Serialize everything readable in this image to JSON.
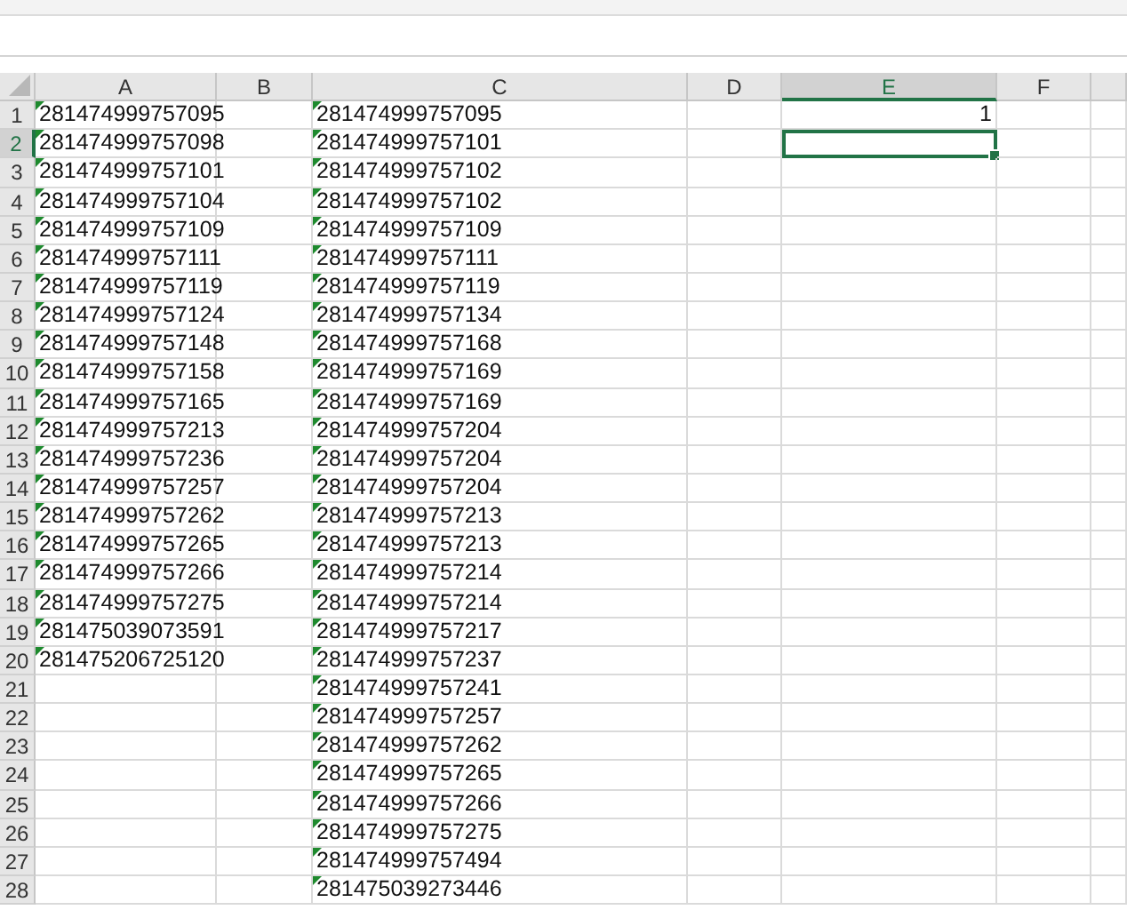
{
  "columns": [
    {
      "label": "A",
      "selected": false
    },
    {
      "label": "B",
      "selected": false
    },
    {
      "label": "C",
      "selected": false
    },
    {
      "label": "D",
      "selected": false
    },
    {
      "label": "E",
      "selected": true
    },
    {
      "label": "F",
      "selected": false
    }
  ],
  "rows": [
    {
      "number": "1",
      "selected": false,
      "cells": [
        {
          "value": "281474999757095",
          "flag": true,
          "selected": false
        },
        {
          "flag": false,
          "selected": false
        },
        {
          "value": "281474999757095",
          "flag": true,
          "selected": false
        },
        {
          "flag": false,
          "selected": false
        },
        {
          "value": "1",
          "flag": false,
          "selected": false
        },
        {
          "flag": false,
          "selected": false
        }
      ]
    },
    {
      "number": "2",
      "selected": true,
      "cells": [
        {
          "value": "281474999757098",
          "flag": true,
          "selected": false
        },
        {
          "flag": false,
          "selected": false
        },
        {
          "value": "281474999757101",
          "flag": true,
          "selected": false
        },
        {
          "flag": false,
          "selected": false
        },
        {
          "flag": false,
          "selected": true
        },
        {
          "flag": false,
          "selected": false
        }
      ]
    },
    {
      "number": "3",
      "selected": false,
      "cells": [
        {
          "value": "281474999757101",
          "flag": true,
          "selected": false
        },
        {
          "flag": false,
          "selected": false
        },
        {
          "value": "281474999757102",
          "flag": true,
          "selected": false
        },
        {
          "flag": false,
          "selected": false
        },
        {
          "flag": false,
          "selected": false
        },
        {
          "flag": false,
          "selected": false
        }
      ]
    },
    {
      "number": "4",
      "selected": false,
      "cells": [
        {
          "value": "281474999757104",
          "flag": true,
          "selected": false
        },
        {
          "flag": false,
          "selected": false
        },
        {
          "value": "281474999757102",
          "flag": true,
          "selected": false
        },
        {
          "flag": false,
          "selected": false
        },
        {
          "flag": false,
          "selected": false
        },
        {
          "flag": false,
          "selected": false
        }
      ]
    },
    {
      "number": "5",
      "selected": false,
      "cells": [
        {
          "value": "281474999757109",
          "flag": true,
          "selected": false
        },
        {
          "flag": false,
          "selected": false
        },
        {
          "value": "281474999757109",
          "flag": true,
          "selected": false
        },
        {
          "flag": false,
          "selected": false
        },
        {
          "flag": false,
          "selected": false
        },
        {
          "flag": false,
          "selected": false
        }
      ]
    },
    {
      "number": "6",
      "selected": false,
      "cells": [
        {
          "value": "281474999757111",
          "flag": true,
          "selected": false
        },
        {
          "flag": false,
          "selected": false
        },
        {
          "value": "281474999757111",
          "flag": true,
          "selected": false
        },
        {
          "flag": false,
          "selected": false
        },
        {
          "flag": false,
          "selected": false
        },
        {
          "flag": false,
          "selected": false
        }
      ]
    },
    {
      "number": "7",
      "selected": false,
      "cells": [
        {
          "value": "281474999757119",
          "flag": true,
          "selected": false
        },
        {
          "flag": false,
          "selected": false
        },
        {
          "value": "281474999757119",
          "flag": true,
          "selected": false
        },
        {
          "flag": false,
          "selected": false
        },
        {
          "flag": false,
          "selected": false
        },
        {
          "flag": false,
          "selected": false
        }
      ]
    },
    {
      "number": "8",
      "selected": false,
      "cells": [
        {
          "value": "281474999757124",
          "flag": true,
          "selected": false
        },
        {
          "flag": false,
          "selected": false
        },
        {
          "value": "281474999757134",
          "flag": true,
          "selected": false
        },
        {
          "flag": false,
          "selected": false
        },
        {
          "flag": false,
          "selected": false
        },
        {
          "flag": false,
          "selected": false
        }
      ]
    },
    {
      "number": "9",
      "selected": false,
      "cells": [
        {
          "value": "281474999757148",
          "flag": true,
          "selected": false
        },
        {
          "flag": false,
          "selected": false
        },
        {
          "value": "281474999757168",
          "flag": true,
          "selected": false
        },
        {
          "flag": false,
          "selected": false
        },
        {
          "flag": false,
          "selected": false
        },
        {
          "flag": false,
          "selected": false
        }
      ]
    },
    {
      "number": "10",
      "selected": false,
      "cells": [
        {
          "value": "281474999757158",
          "flag": true,
          "selected": false
        },
        {
          "flag": false,
          "selected": false
        },
        {
          "value": "281474999757169",
          "flag": true,
          "selected": false
        },
        {
          "flag": false,
          "selected": false
        },
        {
          "flag": false,
          "selected": false
        },
        {
          "flag": false,
          "selected": false
        }
      ]
    },
    {
      "number": "11",
      "selected": false,
      "cells": [
        {
          "value": "281474999757165",
          "flag": true,
          "selected": false
        },
        {
          "flag": false,
          "selected": false
        },
        {
          "value": "281474999757169",
          "flag": true,
          "selected": false
        },
        {
          "flag": false,
          "selected": false
        },
        {
          "flag": false,
          "selected": false
        },
        {
          "flag": false,
          "selected": false
        }
      ]
    },
    {
      "number": "12",
      "selected": false,
      "cells": [
        {
          "value": "281474999757213",
          "flag": true,
          "selected": false
        },
        {
          "flag": false,
          "selected": false
        },
        {
          "value": "281474999757204",
          "flag": true,
          "selected": false
        },
        {
          "flag": false,
          "selected": false
        },
        {
          "flag": false,
          "selected": false
        },
        {
          "flag": false,
          "selected": false
        }
      ]
    },
    {
      "number": "13",
      "selected": false,
      "cells": [
        {
          "value": "281474999757236",
          "flag": true,
          "selected": false
        },
        {
          "flag": false,
          "selected": false
        },
        {
          "value": "281474999757204",
          "flag": true,
          "selected": false
        },
        {
          "flag": false,
          "selected": false
        },
        {
          "flag": false,
          "selected": false
        },
        {
          "flag": false,
          "selected": false
        }
      ]
    },
    {
      "number": "14",
      "selected": false,
      "cells": [
        {
          "value": "281474999757257",
          "flag": true,
          "selected": false
        },
        {
          "flag": false,
          "selected": false
        },
        {
          "value": "281474999757204",
          "flag": true,
          "selected": false
        },
        {
          "flag": false,
          "selected": false
        },
        {
          "flag": false,
          "selected": false
        },
        {
          "flag": false,
          "selected": false
        }
      ]
    },
    {
      "number": "15",
      "selected": false,
      "cells": [
        {
          "value": "281474999757262",
          "flag": true,
          "selected": false
        },
        {
          "flag": false,
          "selected": false
        },
        {
          "value": "281474999757213",
          "flag": true,
          "selected": false
        },
        {
          "flag": false,
          "selected": false
        },
        {
          "flag": false,
          "selected": false
        },
        {
          "flag": false,
          "selected": false
        }
      ]
    },
    {
      "number": "16",
      "selected": false,
      "cells": [
        {
          "value": "281474999757265",
          "flag": true,
          "selected": false
        },
        {
          "flag": false,
          "selected": false
        },
        {
          "value": "281474999757213",
          "flag": true,
          "selected": false
        },
        {
          "flag": false,
          "selected": false
        },
        {
          "flag": false,
          "selected": false
        },
        {
          "flag": false,
          "selected": false
        }
      ]
    },
    {
      "number": "17",
      "selected": false,
      "cells": [
        {
          "value": "281474999757266",
          "flag": true,
          "selected": false
        },
        {
          "flag": false,
          "selected": false
        },
        {
          "value": "281474999757214",
          "flag": true,
          "selected": false
        },
        {
          "flag": false,
          "selected": false
        },
        {
          "flag": false,
          "selected": false
        },
        {
          "flag": false,
          "selected": false
        }
      ]
    },
    {
      "number": "18",
      "selected": false,
      "cells": [
        {
          "value": "281474999757275",
          "flag": true,
          "selected": false
        },
        {
          "flag": false,
          "selected": false
        },
        {
          "value": "281474999757214",
          "flag": true,
          "selected": false
        },
        {
          "flag": false,
          "selected": false
        },
        {
          "flag": false,
          "selected": false
        },
        {
          "flag": false,
          "selected": false
        }
      ]
    },
    {
      "number": "19",
      "selected": false,
      "cells": [
        {
          "value": "281475039073591",
          "flag": true,
          "selected": false
        },
        {
          "flag": false,
          "selected": false
        },
        {
          "value": "281474999757217",
          "flag": true,
          "selected": false
        },
        {
          "flag": false,
          "selected": false
        },
        {
          "flag": false,
          "selected": false
        },
        {
          "flag": false,
          "selected": false
        }
      ]
    },
    {
      "number": "20",
      "selected": false,
      "cells": [
        {
          "value": "281475206725120",
          "flag": true,
          "selected": false
        },
        {
          "flag": false,
          "selected": false
        },
        {
          "value": "281474999757237",
          "flag": true,
          "selected": false
        },
        {
          "flag": false,
          "selected": false
        },
        {
          "flag": false,
          "selected": false
        },
        {
          "flag": false,
          "selected": false
        }
      ]
    },
    {
      "number": "21",
      "selected": false,
      "cells": [
        {
          "flag": false,
          "selected": false
        },
        {
          "flag": false,
          "selected": false
        },
        {
          "value": "281474999757241",
          "flag": true,
          "selected": false
        },
        {
          "flag": false,
          "selected": false
        },
        {
          "flag": false,
          "selected": false
        },
        {
          "flag": false,
          "selected": false
        }
      ]
    },
    {
      "number": "22",
      "selected": false,
      "cells": [
        {
          "flag": false,
          "selected": false
        },
        {
          "flag": false,
          "selected": false
        },
        {
          "value": "281474999757257",
          "flag": true,
          "selected": false
        },
        {
          "flag": false,
          "selected": false
        },
        {
          "flag": false,
          "selected": false
        },
        {
          "flag": false,
          "selected": false
        }
      ]
    },
    {
      "number": "23",
      "selected": false,
      "cells": [
        {
          "flag": false,
          "selected": false
        },
        {
          "flag": false,
          "selected": false
        },
        {
          "value": "281474999757262",
          "flag": true,
          "selected": false
        },
        {
          "flag": false,
          "selected": false
        },
        {
          "flag": false,
          "selected": false
        },
        {
          "flag": false,
          "selected": false
        }
      ]
    },
    {
      "number": "24",
      "selected": false,
      "cells": [
        {
          "flag": false,
          "selected": false
        },
        {
          "flag": false,
          "selected": false
        },
        {
          "value": "281474999757265",
          "flag": true,
          "selected": false
        },
        {
          "flag": false,
          "selected": false
        },
        {
          "flag": false,
          "selected": false
        },
        {
          "flag": false,
          "selected": false
        }
      ]
    },
    {
      "number": "25",
      "selected": false,
      "cells": [
        {
          "flag": false,
          "selected": false
        },
        {
          "flag": false,
          "selected": false
        },
        {
          "value": "281474999757266",
          "flag": true,
          "selected": false
        },
        {
          "flag": false,
          "selected": false
        },
        {
          "flag": false,
          "selected": false
        },
        {
          "flag": false,
          "selected": false
        }
      ]
    },
    {
      "number": "26",
      "selected": false,
      "cells": [
        {
          "flag": false,
          "selected": false
        },
        {
          "flag": false,
          "selected": false
        },
        {
          "value": "281474999757275",
          "flag": true,
          "selected": false
        },
        {
          "flag": false,
          "selected": false
        },
        {
          "flag": false,
          "selected": false
        },
        {
          "flag": false,
          "selected": false
        }
      ]
    },
    {
      "number": "27",
      "selected": false,
      "cells": [
        {
          "flag": false,
          "selected": false
        },
        {
          "flag": false,
          "selected": false
        },
        {
          "value": "281474999757494",
          "flag": true,
          "selected": false
        },
        {
          "flag": false,
          "selected": false
        },
        {
          "flag": false,
          "selected": false
        },
        {
          "flag": false,
          "selected": false
        }
      ]
    },
    {
      "number": "28",
      "selected": false,
      "cells": [
        {
          "flag": false,
          "selected": false
        },
        {
          "flag": false,
          "selected": false
        },
        {
          "value": "281475039273446",
          "flag": true,
          "selected": false
        },
        {
          "flag": false,
          "selected": false
        },
        {
          "flag": false,
          "selected": false
        },
        {
          "flag": false,
          "selected": false
        }
      ]
    }
  ]
}
